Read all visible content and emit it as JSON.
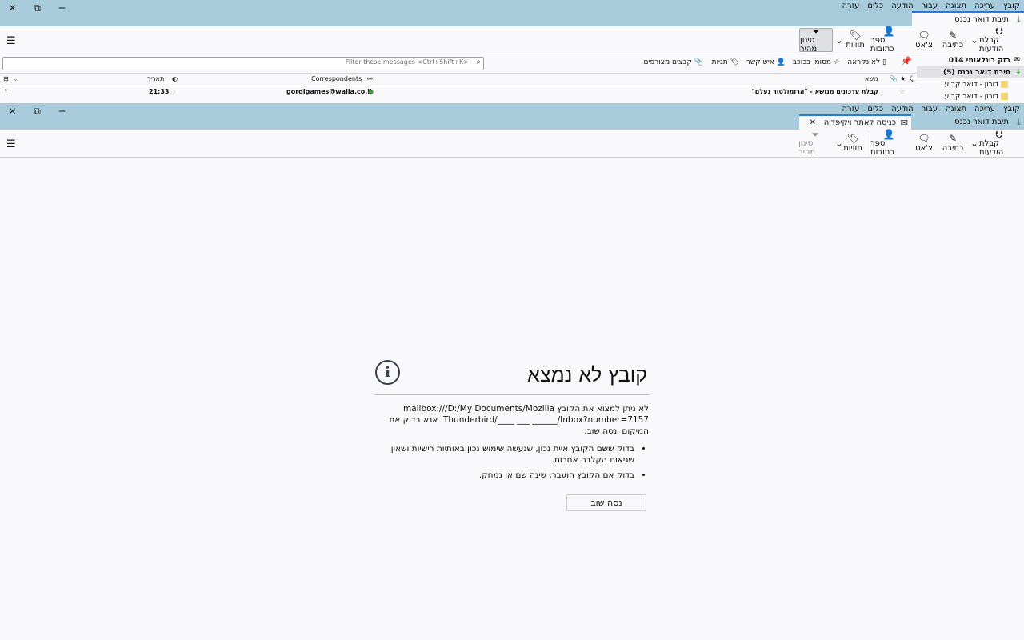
{
  "menu": [
    "קובץ",
    "עריכה",
    "תצוגה",
    "עבור",
    "הודעה",
    "כלים",
    "עזרה"
  ],
  "window1": {
    "tabs": [
      {
        "label": "תיבת דואר נכנס"
      }
    ],
    "toolbar": {
      "get_messages": "קבלת הודעות",
      "write": "כתיבה",
      "chat": "צ'אט",
      "address_book": "ספר כתובות",
      "tags": "תוויות",
      "quick_filter": "סינון מהיר"
    },
    "folders": [
      {
        "label": "בזק בינלאומי 014"
      },
      {
        "label": "תיבת דואר נכנס (5)"
      },
      {
        "label": "דורון - דואר קבוע"
      },
      {
        "label": "דורון - דואר קבוע"
      }
    ],
    "quick_filter_bar": {
      "unread": "לא נקראה",
      "starred": "מסומן בכוכב",
      "contact": "איש קשר",
      "tags": "תגיות",
      "attachment": "קבצים מצורפים",
      "search_placeholder": "Filter these messages <Ctrl+Shift+K>"
    },
    "columns": {
      "subject": "נושא",
      "correspondents": "Correspondents",
      "date": "תאריך"
    },
    "messages": [
      {
        "subject": "קבלת עדכונים מנושא - \"הרומולטור נעלם\"",
        "correspondent": "gordigames@walla.co.il",
        "date": "21:33"
      }
    ]
  },
  "window2": {
    "tabs": [
      {
        "label": "תיבת דואר נכנס"
      },
      {
        "label": "כניסה לאתר ויקיפדיה בתור"
      }
    ],
    "toolbar": {
      "get_messages": "קבלת הודעות",
      "write": "כתיבה",
      "chat": "צ'אט",
      "address_book": "ספר כתובות",
      "tags": "תוויות",
      "quick_filter": "סינון מהיר"
    },
    "error": {
      "title": "קובץ לא נמצא",
      "description": "לא ניתן למצוא את הקובץ mailbox:///D:/My Documents/Mozilla Thunderbird/____ ___ ______/Inbox?number=7157. אנא בדוק את המיקום ונסה שוב.",
      "tips": [
        "בדוק ששם הקובץ איית נכון, שנעשה שימוש נכון באותיות רישיות ושאין שגיאות הקלדה אחרות.",
        "בדוק אם הקובץ הועבר, שינה שם או נמחק."
      ],
      "retry": "נסה שוב"
    }
  },
  "colors": {
    "titlebar": "#a7cbdb",
    "background": "#f9f9fb",
    "accent": "#2a7bd6"
  },
  "icons": [
    "close-icon",
    "restore-icon",
    "minimize-icon",
    "download-icon",
    "pencil-icon",
    "chat-icon",
    "contacts-icon",
    "tag-icon",
    "filter-icon",
    "menu-icon",
    "info-icon",
    "envelope-icon",
    "star-icon",
    "search-icon",
    "pin-icon",
    "folder-icon",
    "paperclip-icon"
  ]
}
